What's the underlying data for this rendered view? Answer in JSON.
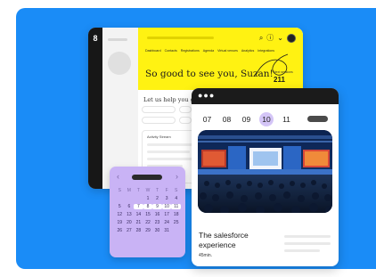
{
  "dashboard": {
    "logo_text": "8",
    "nav": [
      "Dashboard",
      "Contacts",
      "Registrations",
      "Agenda",
      "Virtual venues",
      "Analytics",
      "Integrations"
    ],
    "greeting": "So good to see you, Suzan!",
    "stat_label": "Next sessions",
    "stat_value": "211",
    "help_heading": "Let us help you get",
    "activity_title": "Activity Stream",
    "icons": {
      "search": "search-icon",
      "help": "help-icon",
      "chevron": "chevron-down-icon",
      "avatar": "avatar"
    }
  },
  "calendar": {
    "weekdays": [
      "S",
      "M",
      "T",
      "W",
      "T",
      "F",
      "S"
    ],
    "weeks": [
      [
        "",
        "",
        "",
        "",
        "",
        "",
        ""
      ],
      [
        "",
        "",
        "",
        "1",
        "2",
        "3",
        "4"
      ],
      [
        "5",
        "6",
        "7",
        "8",
        "9",
        "10",
        "11"
      ],
      [
        "12",
        "13",
        "14",
        "15",
        "16",
        "17",
        "18"
      ],
      [
        "19",
        "20",
        "21",
        "22",
        "23",
        "24",
        "25"
      ],
      [
        "26",
        "27",
        "28",
        "29",
        "30",
        "31",
        ""
      ]
    ],
    "selected": [
      "7",
      "8",
      "9",
      "10",
      "11"
    ]
  },
  "event": {
    "dates": [
      "07",
      "08",
      "09",
      "10",
      "11"
    ],
    "active_date": "10",
    "title": "The salesforce experience",
    "duration": "45min."
  },
  "colors": {
    "background": "#1a8cf7",
    "yellow": "#fff212",
    "lavender": "#c9b3f5",
    "dark": "#1b1b1b"
  }
}
